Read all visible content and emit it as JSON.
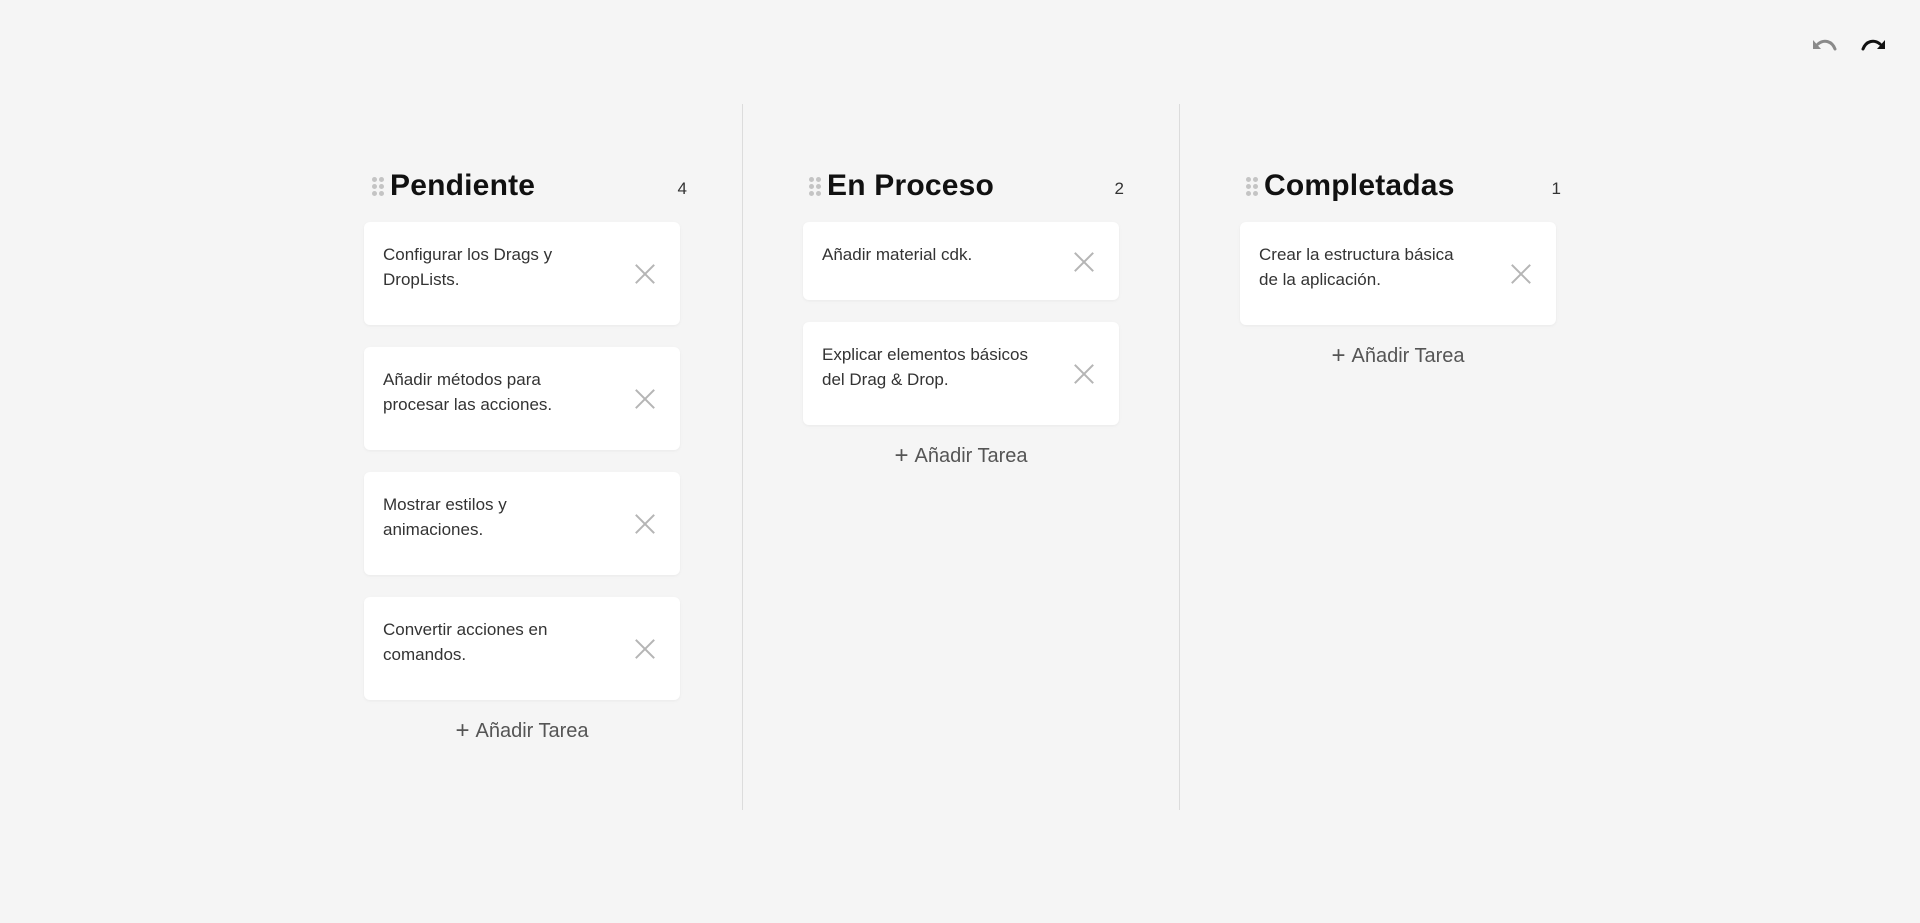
{
  "toolbar": {
    "undo_icon": "undo-icon",
    "redo_icon": "redo-icon"
  },
  "columns": [
    {
      "title": "Pendiente",
      "count": "4",
      "tasks": [
        {
          "text": "Configurar los Drags y DropLists."
        },
        {
          "text": "Añadir métodos para procesar las acciones."
        },
        {
          "text": "Mostrar estilos y animaciones."
        },
        {
          "text": "Convertir acciones en comandos."
        }
      ],
      "add_label": "Añadir Tarea"
    },
    {
      "title": "En Proceso",
      "count": "2",
      "tasks": [
        {
          "text": "Añadir material cdk."
        },
        {
          "text": "Explicar elementos básicos del Drag & Drop."
        }
      ],
      "add_label": "Añadir Tarea"
    },
    {
      "title": "Completadas",
      "count": "1",
      "tasks": [
        {
          "text": "Crear la estructura básica de la aplicación."
        }
      ],
      "add_label": "Añadir Tarea"
    }
  ]
}
